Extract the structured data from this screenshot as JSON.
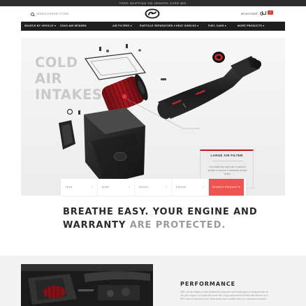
{
  "promo": {
    "text": "FREE SHIPPING ON ORDERS OVER $99"
  },
  "header": {
    "search_placeholder": "SEARCH ENTIRE STORE",
    "account_label": "MY ACCOUNT",
    "cart_count": "0"
  },
  "nav": {
    "items": [
      {
        "label": "SEARCH BY VEHICLE ▾"
      },
      {
        "label": "COLD AIR INTAKES"
      },
      {
        "label": "AIR FILTERS ▾"
      },
      {
        "label": "PARTICLE SEPARATORS ▾"
      },
      {
        "label": "HEAT SHIELDS ▾"
      },
      {
        "label": "FUEL CANS ▾"
      },
      {
        "label": "MORE PRODUCTS ▾"
      }
    ]
  },
  "hero": {
    "title_line1": "COLD",
    "title_line2": "AIR",
    "title_line3": "INTAKES",
    "callout": {
      "title": "LARGE AIR FILTER",
      "text": "Our intake kits come with a massive air filter to achieve a maximum air flow intake."
    }
  },
  "vehicle_selector": {
    "fields": [
      {
        "label": "YEAR"
      },
      {
        "label": "MAKE"
      },
      {
        "label": "MODEL"
      },
      {
        "label": "ENGINE"
      }
    ],
    "button_label": "SEARCH PRODUCTS"
  },
  "tagline": {
    "line1": "BREATHE EASY. YOUR ENGINE AND",
    "line2_main": "WARRANTY ",
    "line2_muted": "ARE PROTECTED."
  },
  "performance": {
    "title": "PERFORMANCE",
    "text": "S&B cold air intakes provide increased horsepower and torque gains by flowing cooler air into your engine. Our intake kits come with a high-performance air filter that delivers up to 56% more air flow than stock. Each intake uses a sealed airbox for maximum protection."
  },
  "colors": {
    "accent_red": "#ef5350",
    "dark_bar": "#1f1f1f",
    "filter_red": "#b71c1c"
  }
}
